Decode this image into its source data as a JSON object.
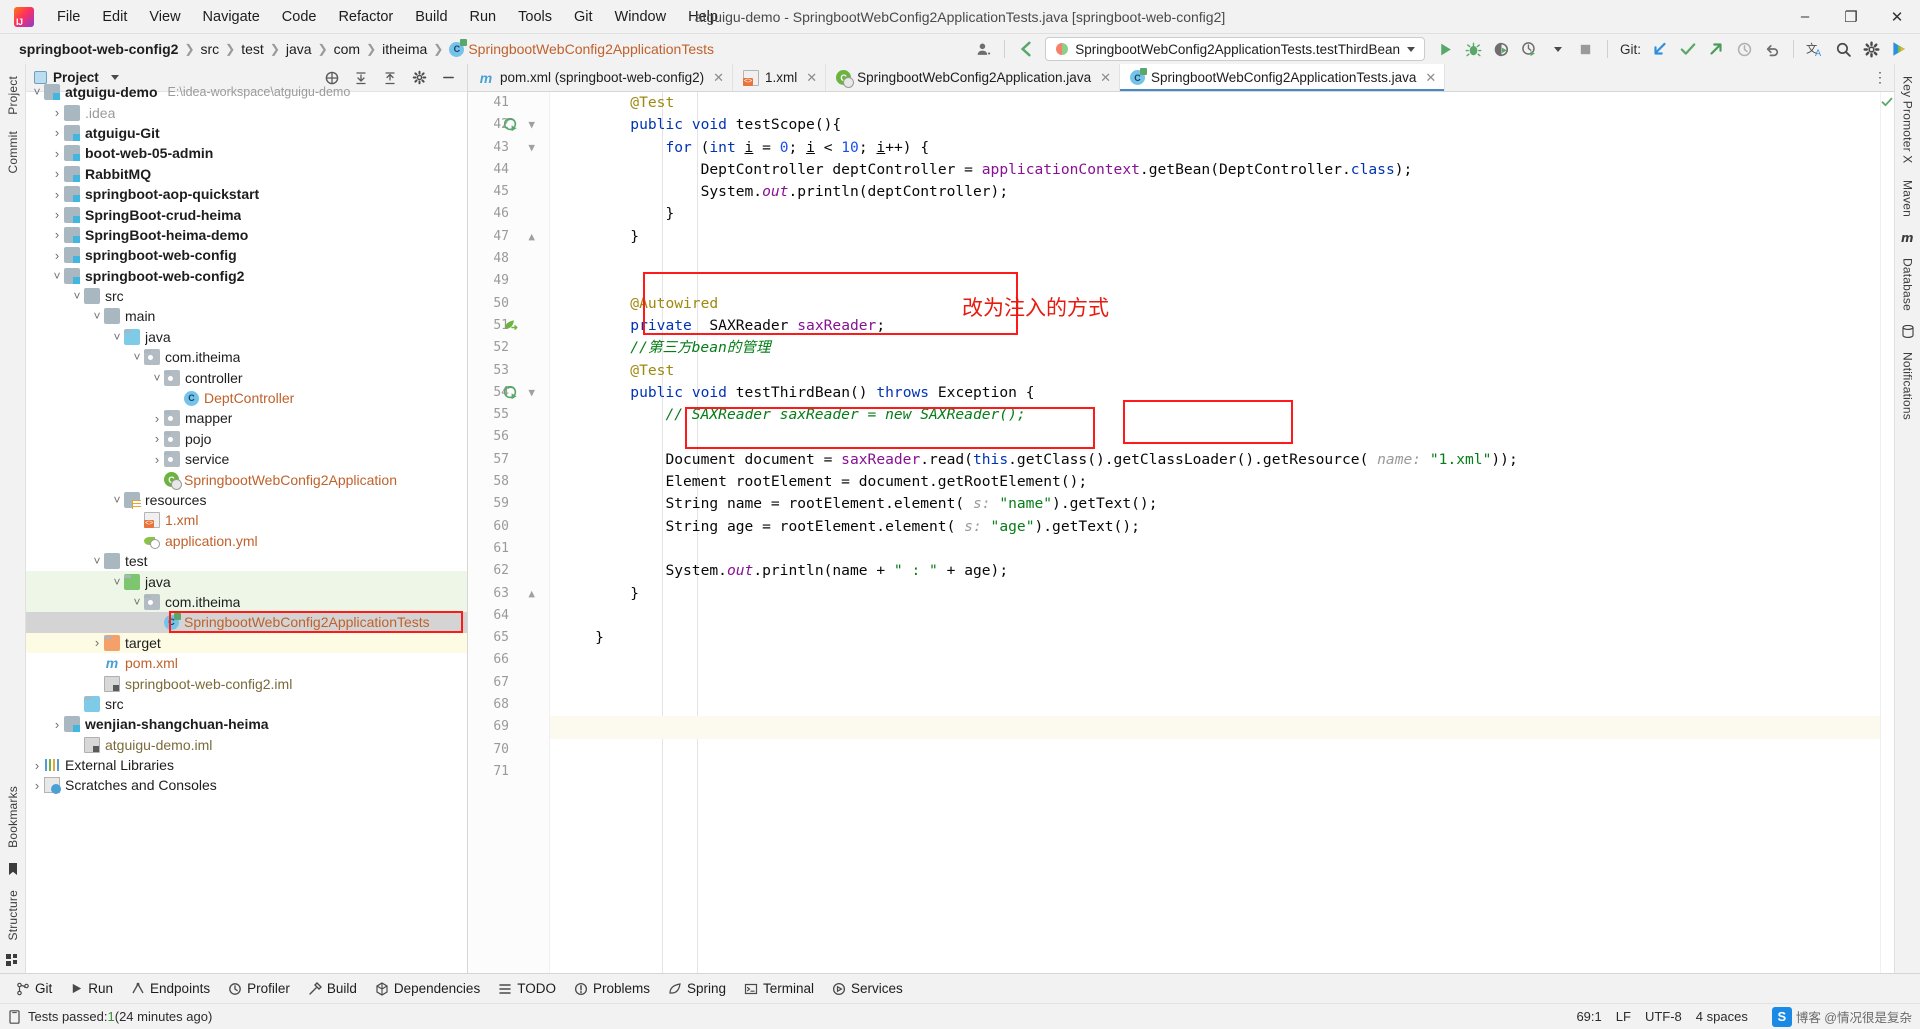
{
  "window": {
    "title": "atguigu-demo - SpringbootWebConfig2ApplicationTests.java [springboot-web-config2]",
    "minimize": "–",
    "maximize": "❐",
    "close": "✕"
  },
  "menu": {
    "items": [
      {
        "label": "File"
      },
      {
        "label": "Edit"
      },
      {
        "label": "View"
      },
      {
        "label": "Navigate"
      },
      {
        "label": "Code"
      },
      {
        "label": "Refactor"
      },
      {
        "label": "Build"
      },
      {
        "label": "Run"
      },
      {
        "label": "Tools"
      },
      {
        "label": "Git"
      },
      {
        "label": "Window"
      },
      {
        "label": "Help"
      }
    ]
  },
  "breadcrumbs": [
    {
      "label": "springboot-web-config2",
      "bold": true
    },
    {
      "label": "src"
    },
    {
      "label": "test"
    },
    {
      "label": "java"
    },
    {
      "label": "com"
    },
    {
      "label": "itheima"
    },
    {
      "label": "SpringbootWebConfig2ApplicationTests",
      "class": true
    }
  ],
  "toolbar": {
    "run_config": "SpringbootWebConfig2ApplicationTests.testThirdBean",
    "git_label": "Git:",
    "run_icon": "run-icon",
    "debug_icon": "debug-icon",
    "coverage_icon": "run-with-coverage-icon",
    "profiler_icon": "profiler-icon",
    "stop_icon": "stop-icon",
    "update_project_icon": "git-update-icon",
    "commit_icon": "git-commit-icon",
    "push_icon": "git-push-icon",
    "history_icon": "git-history-icon",
    "rollback_icon": "git-rollback-icon",
    "translate_icon": "translate-icon",
    "search_icon": "search-everywhere-icon",
    "settings_icon": "settings-gear-icon",
    "ide_icon": "ide-feature-icon"
  },
  "rails": {
    "left_top": [
      "Project"
    ],
    "left_commit": "Commit",
    "left_bottom": [
      "Bookmarks",
      "Structure"
    ],
    "right": [
      "Key Promoter X",
      "Maven",
      "Database",
      "Notifications"
    ]
  },
  "project_panel": {
    "title": "Project",
    "tree": [
      {
        "indent": 0,
        "twist": "v",
        "icon": "folder-module",
        "label": "atguigu-demo",
        "bold": true,
        "path": "E:\\idea-workspace\\atguigu-demo"
      },
      {
        "indent": 1,
        "twist": ">",
        "icon": "folder",
        "label": ".idea",
        "muted": true
      },
      {
        "indent": 1,
        "twist": ">",
        "icon": "folder-module",
        "label": "atguigu-Git",
        "bold": true
      },
      {
        "indent": 1,
        "twist": ">",
        "icon": "folder-module",
        "label": "boot-web-05-admin",
        "bold": true
      },
      {
        "indent": 1,
        "twist": ">",
        "icon": "folder-module",
        "label": "RabbitMQ",
        "bold": true
      },
      {
        "indent": 1,
        "twist": ">",
        "icon": "folder-module",
        "label": "springboot-aop-quickstart",
        "bold": true
      },
      {
        "indent": 1,
        "twist": ">",
        "icon": "folder-module",
        "label": "SpringBoot-crud-heima",
        "bold": true
      },
      {
        "indent": 1,
        "twist": ">",
        "icon": "folder-module",
        "label": "SpringBoot-heima-demo",
        "bold": true
      },
      {
        "indent": 1,
        "twist": ">",
        "icon": "folder-module",
        "label": "springboot-web-config",
        "bold": true
      },
      {
        "indent": 1,
        "twist": "v",
        "icon": "folder-module",
        "label": "springboot-web-config2",
        "bold": true
      },
      {
        "indent": 2,
        "twist": "v",
        "icon": "folder",
        "label": "src"
      },
      {
        "indent": 3,
        "twist": "v",
        "icon": "folder",
        "label": "main"
      },
      {
        "indent": 4,
        "twist": "v",
        "icon": "folder-source",
        "label": "java"
      },
      {
        "indent": 5,
        "twist": "v",
        "icon": "package",
        "label": "com.itheima"
      },
      {
        "indent": 6,
        "twist": "v",
        "icon": "package",
        "label": "controller"
      },
      {
        "indent": 7,
        "twist": "",
        "icon": "class",
        "label": "DeptController",
        "color": "#c0612b"
      },
      {
        "indent": 6,
        "twist": ">",
        "icon": "package",
        "label": "mapper"
      },
      {
        "indent": 6,
        "twist": ">",
        "icon": "package",
        "label": "pojo"
      },
      {
        "indent": 6,
        "twist": ">",
        "icon": "package",
        "label": "service"
      },
      {
        "indent": 6,
        "twist": "",
        "icon": "spring-class",
        "label": "SpringbootWebConfig2Application",
        "color": "#c0612b"
      },
      {
        "indent": 4,
        "twist": "v",
        "icon": "folder-resource",
        "label": "resources"
      },
      {
        "indent": 5,
        "twist": "",
        "icon": "xml",
        "label": "1.xml",
        "color": "#c0612b"
      },
      {
        "indent": 5,
        "twist": "",
        "icon": "yml",
        "label": "application.yml",
        "color": "#c0612b"
      },
      {
        "indent": 3,
        "twist": "v",
        "icon": "folder",
        "label": "test"
      },
      {
        "indent": 4,
        "twist": "v",
        "icon": "folder-test-source",
        "label": "java",
        "rowbg": "green"
      },
      {
        "indent": 5,
        "twist": "v",
        "icon": "package",
        "label": "com.itheima",
        "rowbg": "green"
      },
      {
        "indent": 6,
        "twist": "",
        "icon": "test-class",
        "label": "SpringbootWebConfig2ApplicationTests",
        "color": "#c0612b",
        "rowbg": "selected",
        "boxed": true
      },
      {
        "indent": 3,
        "twist": ">",
        "icon": "folder-target",
        "label": "target",
        "rowbg": "yellow"
      },
      {
        "indent": 3,
        "twist": "",
        "icon": "maven",
        "label": "pom.xml",
        "color": "#c0612b"
      },
      {
        "indent": 3,
        "twist": "",
        "icon": "iml",
        "label": "springboot-web-config2.iml",
        "color": "#7a6a3a"
      },
      {
        "indent": 2,
        "twist": "",
        "icon": "folder-source",
        "label": "src"
      },
      {
        "indent": 1,
        "twist": ">",
        "icon": "folder-module",
        "label": "wenjian-shangchuan-heima",
        "bold": true
      },
      {
        "indent": 2,
        "twist": "",
        "icon": "iml",
        "label": "atguigu-demo.iml",
        "color": "#7a6a3a"
      },
      {
        "indent": 0,
        "twist": ">",
        "icon": "libraries",
        "label": "External Libraries"
      },
      {
        "indent": 0,
        "twist": ">",
        "icon": "scratches",
        "label": "Scratches and Consoles"
      }
    ]
  },
  "editor_tabs": [
    {
      "label": "pom.xml (springboot-web-config2)",
      "icon": "maven-icon",
      "active": false
    },
    {
      "label": "1.xml",
      "icon": "xml-icon",
      "active": false
    },
    {
      "label": "SpringbootWebConfig2Application.java",
      "icon": "spring-class-icon",
      "active": false
    },
    {
      "label": "SpringbootWebConfig2ApplicationTests.java",
      "icon": "test-class-icon",
      "active": true
    }
  ],
  "code": {
    "first_line": 41,
    "lines": [
      {
        "n": 41,
        "runmark": false,
        "fold": "",
        "html": "        <span class=\"ann\">@Test</span>"
      },
      {
        "n": 42,
        "runmark": true,
        "fold": "-",
        "html": "        <span class=\"kw\">public</span> <span class=\"kw\">void</span> <span class=\"plain\">testScope</span><span class=\"plain\">(){</span>"
      },
      {
        "n": 43,
        "runmark": false,
        "fold": "-",
        "html": "            <span class=\"kw\">for</span> <span class=\"plain\">(</span><span class=\"kw\">int</span> <span class=\"plain udl\">i</span> <span class=\"plain\">= </span><span class=\"num\">0</span><span class=\"plain\">; </span><span class=\"plain udl\">i</span> <span class=\"plain\">&lt; </span><span class=\"num\">10</span><span class=\"plain\">; </span><span class=\"plain udl\">i</span><span class=\"plain\">++) {</span>"
      },
      {
        "n": 44,
        "runmark": false,
        "fold": "",
        "html": "                <span class=\"plain\">DeptController deptController = </span><span class=\"fld\">applicationContext</span><span class=\"plain\">.getBean(DeptController.</span><span class=\"kw\">class</span><span class=\"plain\">);</span>"
      },
      {
        "n": 45,
        "runmark": false,
        "fold": "",
        "html": "                <span class=\"plain\">System.</span><span class=\"stat\">out</span><span class=\"plain\">.println(deptController);</span>"
      },
      {
        "n": 46,
        "runmark": false,
        "fold": "",
        "html": "            <span class=\"plain\">}</span>"
      },
      {
        "n": 47,
        "runmark": false,
        "fold": "^",
        "html": "        <span class=\"plain\">}</span>"
      },
      {
        "n": 48,
        "runmark": false,
        "fold": "",
        "html": ""
      },
      {
        "n": 49,
        "runmark": false,
        "fold": "",
        "html": ""
      },
      {
        "n": 50,
        "runmark": false,
        "fold": "",
        "html": "        <span class=\"ann\">@Autowired</span>"
      },
      {
        "n": 51,
        "runmark": false,
        "bean": true,
        "fold": "",
        "html": "        <span class=\"kw\">private</span>  <span class=\"plain\">SAXReader </span><span class=\"fld\">saxReader</span><span class=\"plain\">;</span>"
      },
      {
        "n": 52,
        "runmark": false,
        "fold": "",
        "html": "        <span class=\"cmt-i\">//第三方bean的管理</span>"
      },
      {
        "n": 53,
        "runmark": false,
        "fold": "",
        "html": "        <span class=\"ann\">@Test</span>"
      },
      {
        "n": 54,
        "runmark": true,
        "fold": "-",
        "html": "        <span class=\"kw\">public</span> <span class=\"kw\">void</span> <span class=\"plain\">testThirdBean() </span><span class=\"kw\">throws</span> <span class=\"plain\">Exception {</span>"
      },
      {
        "n": 55,
        "runmark": false,
        "fold": "",
        "html": "            <span class=\"cmt-i\">// SAXReader saxReader = new SAXReader();</span>"
      },
      {
        "n": 56,
        "runmark": false,
        "fold": "",
        "html": ""
      },
      {
        "n": 57,
        "runmark": false,
        "fold": "",
        "html": "            <span class=\"plain\">Document document = </span><span class=\"fld\">saxReader</span><span class=\"plain\">.read(</span><span class=\"kw\">this</span><span class=\"plain\">.getClass().getClassLoader().getResource(</span><span class=\"hint\">&nbsp;name:&nbsp;</span><span class=\"str\">\"1.xml\"</span><span class=\"plain\">));</span>"
      },
      {
        "n": 58,
        "runmark": false,
        "fold": "",
        "html": "            <span class=\"plain\">Element rootElement = document.getRootElement();</span>"
      },
      {
        "n": 59,
        "runmark": false,
        "fold": "",
        "html": "            <span class=\"plain\">String name = rootElement.element(</span><span class=\"hint\">&nbsp;s:&nbsp;</span><span class=\"str\">\"name\"</span><span class=\"plain\">).getText();</span>"
      },
      {
        "n": 60,
        "runmark": false,
        "fold": "",
        "html": "            <span class=\"plain\">String age = rootElement.element(</span><span class=\"hint\">&nbsp;s:&nbsp;</span><span class=\"str\">\"age\"</span><span class=\"plain\">).getText();</span>"
      },
      {
        "n": 61,
        "runmark": false,
        "fold": "",
        "html": ""
      },
      {
        "n": 62,
        "runmark": false,
        "fold": "",
        "html": "            <span class=\"plain\">System.</span><span class=\"stat\">out</span><span class=\"plain\">.println(name + </span><span class=\"str\">\" : \"</span><span class=\"plain\"> + age);</span>"
      },
      {
        "n": 63,
        "runmark": false,
        "fold": "^",
        "html": "        <span class=\"plain\">}</span>"
      },
      {
        "n": 64,
        "runmark": false,
        "fold": "",
        "html": ""
      },
      {
        "n": 65,
        "runmark": false,
        "fold": "",
        "html": "    <span class=\"plain\">}</span>"
      },
      {
        "n": 66,
        "runmark": false,
        "fold": "",
        "html": ""
      },
      {
        "n": 67,
        "runmark": false,
        "fold": "",
        "html": ""
      },
      {
        "n": 68,
        "runmark": false,
        "fold": "",
        "html": ""
      },
      {
        "n": 69,
        "runmark": false,
        "fold": "",
        "highlight": true,
        "html": ""
      },
      {
        "n": 70,
        "runmark": false,
        "fold": "",
        "html": ""
      },
      {
        "n": 71,
        "runmark": false,
        "fold": "",
        "html": ""
      }
    ]
  },
  "annotations": {
    "note_cn": "改为注入的方式"
  },
  "bottom_bar": [
    {
      "label": "Git",
      "icon": "git-branch-icon"
    },
    {
      "label": "Run",
      "icon": "run-icon"
    },
    {
      "label": "Endpoints",
      "icon": "endpoints-icon"
    },
    {
      "label": "Profiler",
      "icon": "profiler-icon"
    },
    {
      "label": "Build",
      "icon": "build-hammer-icon"
    },
    {
      "label": "Dependencies",
      "icon": "dependencies-icon"
    },
    {
      "label": "TODO",
      "icon": "todo-list-icon"
    },
    {
      "label": "Problems",
      "icon": "problems-icon"
    },
    {
      "label": "Spring",
      "icon": "spring-leaf-icon"
    },
    {
      "label": "Terminal",
      "icon": "terminal-icon"
    },
    {
      "label": "Services",
      "icon": "services-icon"
    }
  ],
  "statusbar": {
    "message_prefix": "Tests passed: ",
    "message_count": "1",
    "message_suffix": " (24 minutes ago)",
    "caret": "69:1",
    "line_sep": "LF",
    "encoding": "UTF-8",
    "indent": "4 spaces",
    "watermark": "博客 @情况很是复杂"
  }
}
